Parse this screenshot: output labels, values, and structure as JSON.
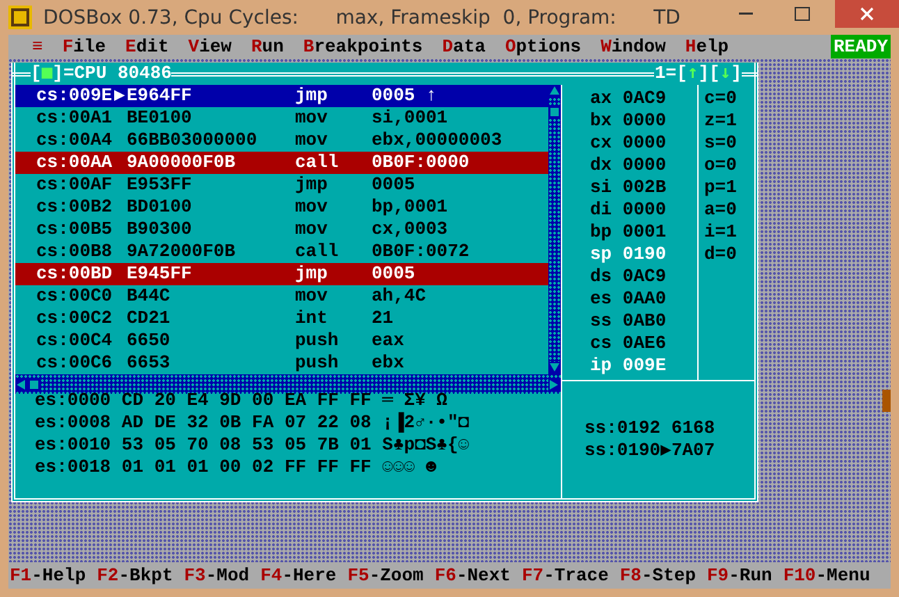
{
  "window": {
    "title": "DOSBox 0.73, Cpu Cycles:      max, Frameskip  0, Program:      TD"
  },
  "menu": [
    {
      "kind": "system",
      "label": "≡"
    },
    {
      "kind": "item",
      "label": "File"
    },
    {
      "kind": "item",
      "label": "Edit"
    },
    {
      "kind": "item",
      "label": "View"
    },
    {
      "kind": "item",
      "label": "Run"
    },
    {
      "kind": "item",
      "label": "Breakpoints"
    },
    {
      "kind": "item",
      "label": "Data"
    },
    {
      "kind": "item",
      "label": "Options"
    },
    {
      "kind": "item",
      "label": "Window"
    },
    {
      "kind": "item",
      "label": "Help"
    }
  ],
  "status": "READY",
  "cpu_window": {
    "close_box": [
      "[",
      "■",
      "]"
    ],
    "title": "=CPU 80486",
    "number": "1=",
    "zoom_up": [
      "[",
      "↑",
      "]"
    ],
    "zoom_down": [
      "[",
      "↓",
      "]"
    ],
    "code_rows": [
      {
        "address": "cs:009E",
        "marker": "▶",
        "bytes": "E964FF",
        "mnemonic": "jmp",
        "operand": "0005 ↑",
        "selected": true,
        "breakpoint": false
      },
      {
        "address": "cs:00A1",
        "bytes": "BE0100",
        "mnemonic": "mov",
        "operand": "si,0001",
        "selected": false,
        "breakpoint": false
      },
      {
        "address": "cs:00A4",
        "bytes": "66BB03000000",
        "mnemonic": "mov",
        "operand": "ebx,00000003",
        "selected": false,
        "breakpoint": false
      },
      {
        "address": "cs:00AA",
        "bytes": "9A00000F0B",
        "mnemonic": "call",
        "operand": "0B0F:0000",
        "selected": false,
        "breakpoint": true
      },
      {
        "address": "cs:00AF",
        "bytes": "E953FF",
        "mnemonic": "jmp",
        "operand": "0005",
        "selected": false,
        "breakpoint": false
      },
      {
        "address": "cs:00B2",
        "bytes": "BD0100",
        "mnemonic": "mov",
        "operand": "bp,0001",
        "selected": false,
        "breakpoint": false
      },
      {
        "address": "cs:00B5",
        "bytes": "B90300",
        "mnemonic": "mov",
        "operand": "cx,0003",
        "selected": false,
        "breakpoint": false
      },
      {
        "address": "cs:00B8",
        "bytes": "9A72000F0B",
        "mnemonic": "call",
        "operand": "0B0F:0072",
        "selected": false,
        "breakpoint": false
      },
      {
        "address": "cs:00BD",
        "bytes": "E945FF",
        "mnemonic": "jmp",
        "operand": "0005",
        "selected": false,
        "breakpoint": true
      },
      {
        "address": "cs:00C0",
        "bytes": "B44C",
        "mnemonic": "mov",
        "operand": "ah,4C",
        "selected": false,
        "breakpoint": false
      },
      {
        "address": "cs:00C2",
        "bytes": "CD21",
        "mnemonic": "int",
        "operand": "21",
        "selected": false,
        "breakpoint": false
      },
      {
        "address": "cs:00C4",
        "bytes": "6650",
        "mnemonic": "push",
        "operand": "eax",
        "selected": false,
        "breakpoint": false
      },
      {
        "address": "cs:00C6",
        "bytes": "6653",
        "mnemonic": "push",
        "operand": "ebx",
        "selected": false,
        "breakpoint": false
      }
    ],
    "registers": [
      {
        "name": "ax",
        "value": "0AC9",
        "changed": false
      },
      {
        "name": "bx",
        "value": "0000",
        "changed": false
      },
      {
        "name": "cx",
        "value": "0000",
        "changed": false
      },
      {
        "name": "dx",
        "value": "0000",
        "changed": false
      },
      {
        "name": "si",
        "value": "002B",
        "changed": false
      },
      {
        "name": "di",
        "value": "0000",
        "changed": false
      },
      {
        "name": "bp",
        "value": "0001",
        "changed": false
      },
      {
        "name": "sp",
        "value": "0190",
        "changed": true
      },
      {
        "name": "ds",
        "value": "0AC9",
        "changed": false
      },
      {
        "name": "es",
        "value": "0AA0",
        "changed": false
      },
      {
        "name": "ss",
        "value": "0AB0",
        "changed": false
      },
      {
        "name": "cs",
        "value": "0AE6",
        "changed": false
      },
      {
        "name": "ip",
        "value": "009E",
        "changed": true
      }
    ],
    "flags": [
      "c=0",
      "z=1",
      "s=0",
      "o=0",
      "p=1",
      "a=0",
      "i=1",
      "d=0"
    ],
    "dump_rows": [
      {
        "address": "es:0000",
        "bytes": "CD 20 E4 9D 00 EA FF FF",
        "ascii": "═ Σ¥ Ω"
      },
      {
        "address": "es:0008",
        "bytes": "AD DE 32 0B FA 07 22 08",
        "ascii": "¡▐2♂·•\"◘"
      },
      {
        "address": "es:0010",
        "bytes": "53 05 70 08 53 05 7B 01",
        "ascii": "S♣p◘S♣{☺"
      },
      {
        "address": "es:0018",
        "bytes": "01 01 01 00 02 FF FF FF",
        "ascii": "☺☺☺ ☻"
      }
    ],
    "stack_rows": [
      {
        "address": "ss:0192",
        "value": "6168"
      },
      {
        "address": "ss:0190",
        "marker": "▶",
        "value": "7A07"
      }
    ]
  },
  "function_keys": [
    {
      "key": "F1",
      "label": "-Help"
    },
    {
      "key": "F2",
      "label": "-Bkpt"
    },
    {
      "key": "F3",
      "label": "-Mod"
    },
    {
      "key": "F4",
      "label": "-Here"
    },
    {
      "key": "F5",
      "label": "-Zoom"
    },
    {
      "key": "F6",
      "label": "-Next"
    },
    {
      "key": "F7",
      "label": "-Trace"
    },
    {
      "key": "F8",
      "label": "-Step"
    },
    {
      "key": "F9",
      "label": "-Run"
    },
    {
      "key": "F10",
      "label": "-Menu"
    }
  ]
}
